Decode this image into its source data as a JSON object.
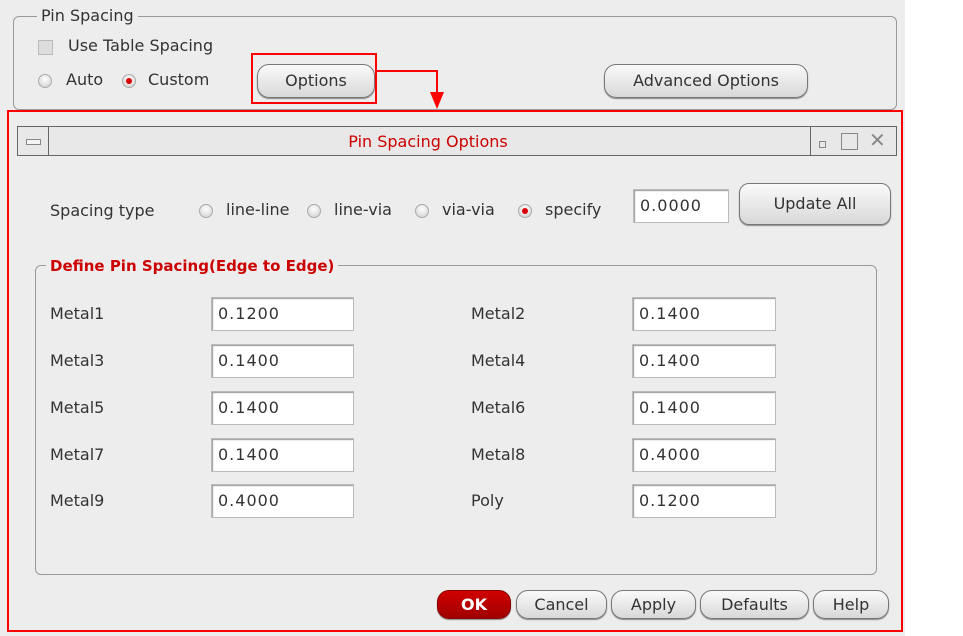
{
  "pin_spacing": {
    "title": "Pin Spacing",
    "use_table_spacing": "Use Table Spacing",
    "use_table_checked": false,
    "auto": "Auto",
    "custom": "Custom",
    "selected": "Custom",
    "options": "Options",
    "advanced_options": "Advanced Options"
  },
  "dialog": {
    "title": "Pin Spacing Options",
    "spacing_type_label": "Spacing type",
    "spacing_types": [
      "line-line",
      "line-via",
      "via-via",
      "specify"
    ],
    "spacing_selected": "specify",
    "spacing_value": "0.0000",
    "update_all": "Update All",
    "group_title": "Define Pin Spacing(Edge to Edge)",
    "layers": [
      {
        "name": "Metal1",
        "value": "0.1200"
      },
      {
        "name": "Metal2",
        "value": "0.1400"
      },
      {
        "name": "Metal3",
        "value": "0.1400"
      },
      {
        "name": "Metal4",
        "value": "0.1400"
      },
      {
        "name": "Metal5",
        "value": "0.1400"
      },
      {
        "name": "Metal6",
        "value": "0.1400"
      },
      {
        "name": "Metal7",
        "value": "0.1400"
      },
      {
        "name": "Metal8",
        "value": "0.4000"
      },
      {
        "name": "Metal9",
        "value": "0.4000"
      },
      {
        "name": "Poly",
        "value": "0.1200"
      }
    ],
    "buttons": {
      "ok": "OK",
      "cancel": "Cancel",
      "apply": "Apply",
      "defaults": "Defaults",
      "help": "Help"
    }
  },
  "colors": {
    "highlight": "#ff0000",
    "title_text": "#cc0000",
    "ok_button": "#b00000"
  }
}
